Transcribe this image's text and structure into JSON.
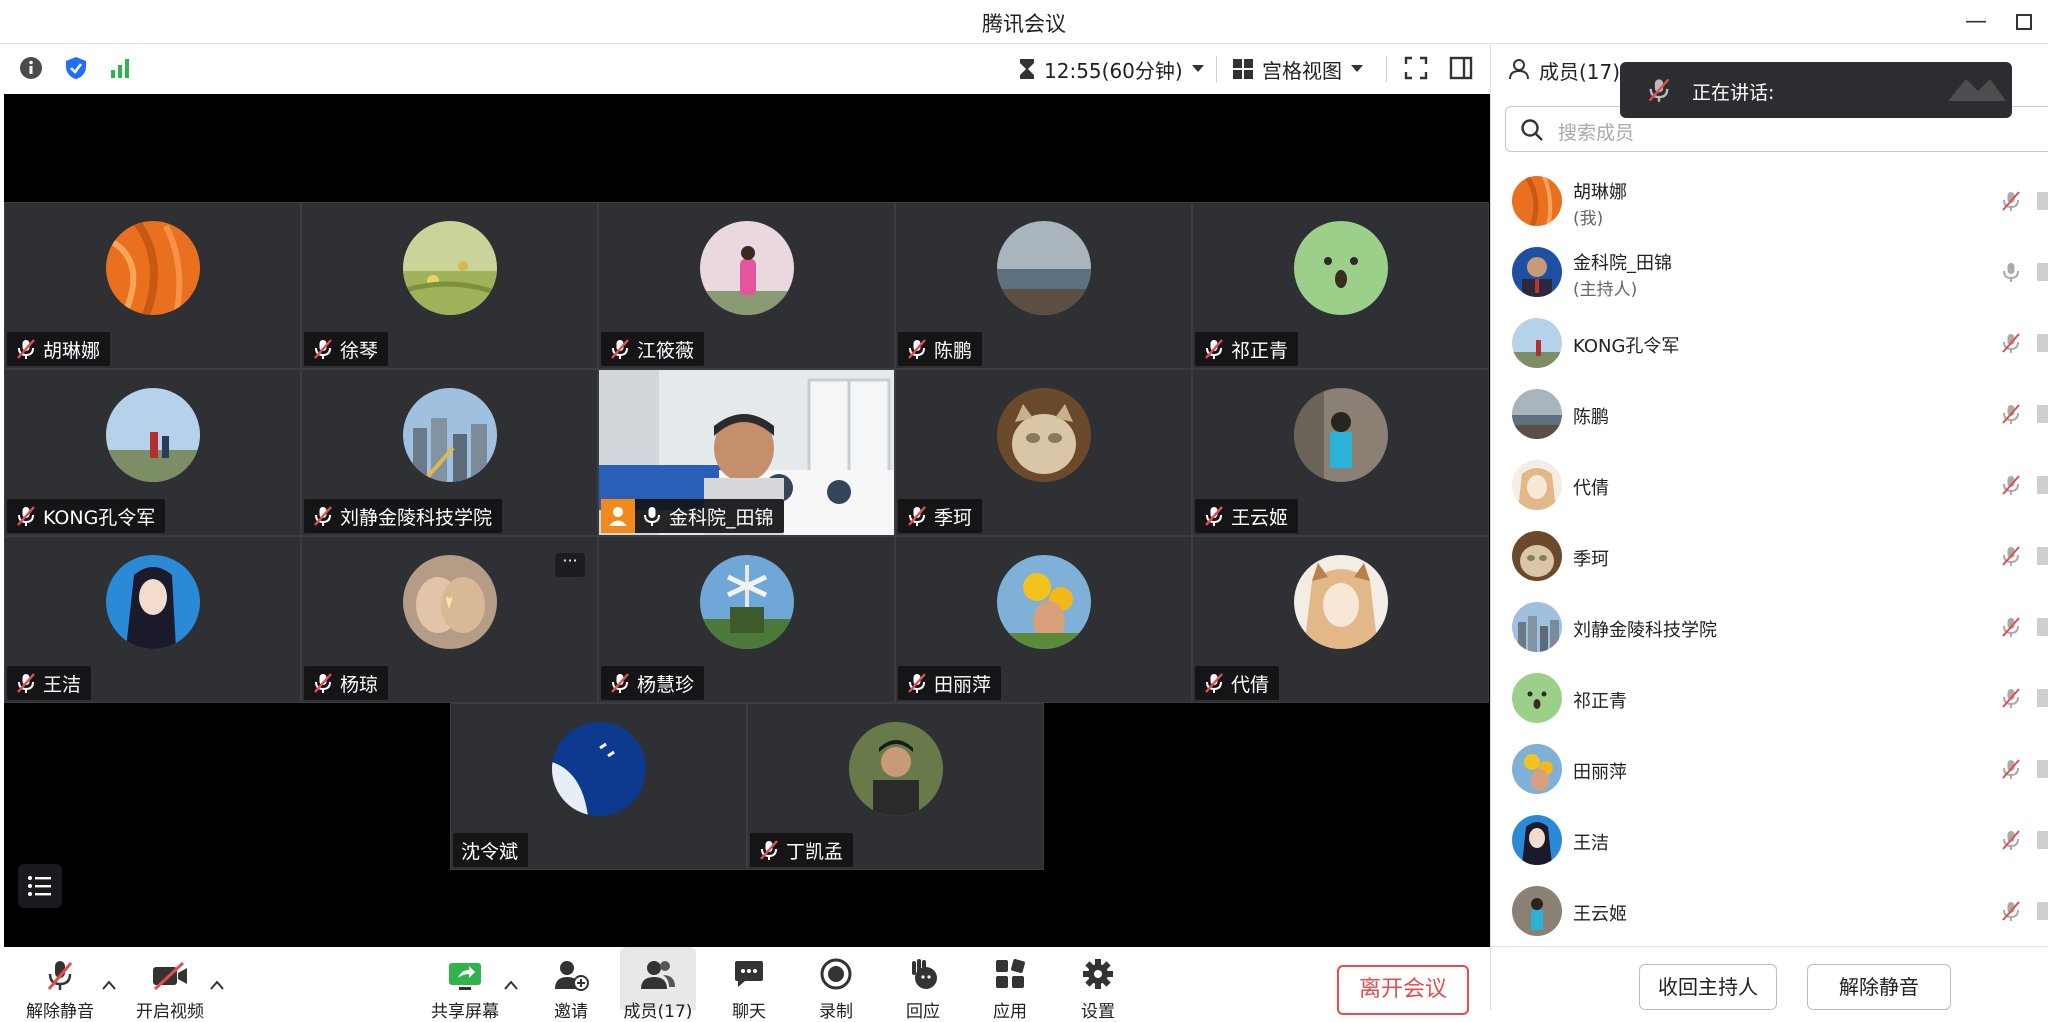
{
  "window": {
    "title": "腾讯会议"
  },
  "topbar": {
    "timer": "12:55(60分钟)",
    "view_label": "宫格视图"
  },
  "tiles": [
    {
      "name": "胡琳娜",
      "muted": true
    },
    {
      "name": "徐琴",
      "muted": true
    },
    {
      "name": "江筱薇",
      "muted": true
    },
    {
      "name": "陈鹏",
      "muted": true
    },
    {
      "name": "祁正青",
      "muted": true
    },
    {
      "name": "KONG孔令军",
      "muted": true
    },
    {
      "name": "刘静金陵科技学院",
      "muted": true
    },
    {
      "name": "金科院_田锦",
      "muted": false
    },
    {
      "name": "季珂",
      "muted": true
    },
    {
      "name": "王云姬",
      "muted": true
    },
    {
      "name": "王洁",
      "muted": true
    },
    {
      "name": "杨琼",
      "muted": true
    },
    {
      "name": "杨慧珍",
      "muted": true
    },
    {
      "name": "田丽萍",
      "muted": true
    },
    {
      "name": "代倩",
      "muted": true
    },
    {
      "name": "沈令斌",
      "muted": false
    },
    {
      "name": "丁凯孟",
      "muted": true
    }
  ],
  "tile_more": "···",
  "bottombar": {
    "unmute": "解除静音",
    "start_video": "开启视频",
    "share_screen": "共享屏幕",
    "invite": "邀请",
    "members": "成员(17)",
    "chat": "聊天",
    "record": "录制",
    "reactions": "回应",
    "apps": "应用",
    "settings": "设置",
    "leave": "离开会议"
  },
  "sidebar": {
    "header": "成员(17)",
    "speaking_popup": "正在讲话:",
    "search_placeholder": "搜索成员",
    "members": [
      {
        "name": "胡琳娜",
        "sub": "(我)"
      },
      {
        "name": "金科院_田锦",
        "sub": "(主持人)"
      },
      {
        "name": "KONG孔令军",
        "sub": ""
      },
      {
        "name": "陈鹏",
        "sub": ""
      },
      {
        "name": "代倩",
        "sub": ""
      },
      {
        "name": "季珂",
        "sub": ""
      },
      {
        "name": "刘静金陵科技学院",
        "sub": ""
      },
      {
        "name": "祁正青",
        "sub": ""
      },
      {
        "name": "田丽萍",
        "sub": ""
      },
      {
        "name": "王洁",
        "sub": ""
      },
      {
        "name": "王云姬",
        "sub": ""
      }
    ],
    "reclaim_host": "收回主持人",
    "unmute_all": "解除静音"
  },
  "colors": {
    "accent": "#1f6fff",
    "danger": "#e34d4d",
    "signal": "#2fb34a"
  }
}
